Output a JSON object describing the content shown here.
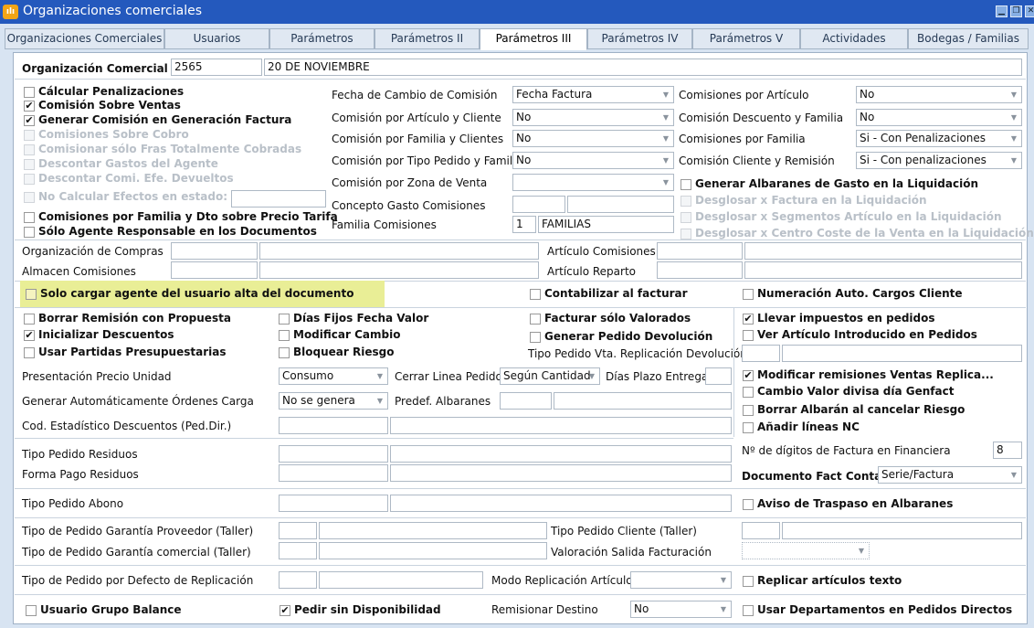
{
  "window": {
    "title": "Organizaciones comerciales",
    "min": "▁",
    "max": "❐",
    "close": "✕"
  },
  "tabs": [
    "Organizaciones Comerciales",
    "Usuarios",
    "Parámetros",
    "Parámetros II",
    "Parámetros III",
    "Parámetros IV",
    "Parámetros V",
    "Actividades",
    "Bodegas / Familias"
  ],
  "org": {
    "label": "Organización Comercial",
    "code": "2565",
    "name": "20 DE NOVIEMBRE"
  },
  "left_checks": [
    {
      "label": "Cálcular Penalizaciones",
      "checked": false,
      "disabled": false
    },
    {
      "label": "Comisión Sobre Ventas",
      "checked": true,
      "disabled": false
    },
    {
      "label": "Generar Comisión en Generación Factura",
      "checked": true,
      "disabled": false
    },
    {
      "label": "Comisiones Sobre Cobro",
      "checked": false,
      "disabled": true
    },
    {
      "label": "Comisionar sólo Fras Totalmente Cobradas",
      "checked": false,
      "disabled": true
    },
    {
      "label": "Descontar Gastos del Agente",
      "checked": false,
      "disabled": true
    },
    {
      "label": "Descontar Comi. Efe. Devueltos",
      "checked": false,
      "disabled": true
    },
    {
      "label": "No Calcular Efectos en estado:",
      "checked": false,
      "disabled": true
    },
    {
      "label": "Comisiones por Familia y Dto sobre Precio Tarifa",
      "checked": false,
      "disabled": false
    },
    {
      "label": "Sólo Agente Responsable en los Documentos",
      "checked": false,
      "disabled": false
    }
  ],
  "mid_fields": [
    {
      "label": "Fecha de Cambio de Comisión",
      "value": "Fecha Factura",
      "type": "select"
    },
    {
      "label": "Comisión por Artículo y Cliente",
      "value": "No",
      "type": "select"
    },
    {
      "label": "Comisión por Familia y Clientes",
      "value": "No",
      "type": "select"
    },
    {
      "label": "Comisión por Tipo Pedido y Familia",
      "value": "No",
      "type": "select"
    },
    {
      "label": "Comisión por Zona de Venta",
      "value": "",
      "type": "select"
    },
    {
      "label": "Concepto Gasto Comisiones",
      "value": "",
      "type": "input"
    },
    {
      "label": "Familia Comisiones",
      "value": "1",
      "value2": "FAMILIAS",
      "type": "input"
    }
  ],
  "right_fields": [
    {
      "label": "Comisiones por Artículo",
      "value": "No"
    },
    {
      "label": "Comisión Descuento y Familia",
      "value": "No"
    },
    {
      "label": "Comisiones por Familia",
      "value": "Si - Con Penalizaciones"
    },
    {
      "label": "Comisión Cliente y Remisión",
      "value": "Si - Con penalizaciones"
    }
  ],
  "right_checks": [
    {
      "label": "Generar Albaranes de Gasto en la Liquidación",
      "disabled": false
    },
    {
      "label": "Desglosar x Factura en la Liquidación",
      "disabled": true
    },
    {
      "label": "Desglosar x Segmentos Artículo en la Liquidación",
      "disabled": true
    },
    {
      "label": "Desglosar x Centro Coste de la Venta en la Liquidación",
      "disabled": true
    }
  ],
  "compras": {
    "label": "Organización de Compras"
  },
  "almacen": {
    "label": "Almacen Comisiones"
  },
  "art_com": {
    "label": "Artículo Comisiones"
  },
  "art_rep": {
    "label": "Artículo Reparto"
  },
  "highlight_check": {
    "label": "Solo cargar agente del usuario alta del documento"
  },
  "contabilizar": {
    "label": "Contabilizar al facturar"
  },
  "numeracion": {
    "label": "Numeración Auto. Cargos Cliente"
  },
  "checks_a": [
    {
      "label": "Borrar Remisión con Propuesta",
      "checked": false
    },
    {
      "label": "Inicializar Descuentos",
      "checked": true
    },
    {
      "label": "Usar Partidas Presupuestarias",
      "checked": false
    }
  ],
  "checks_b": [
    {
      "label": "Días Fijos Fecha Valor",
      "checked": false
    },
    {
      "label": "Modificar Cambio",
      "checked": false
    },
    {
      "label": "Bloquear Riesgo",
      "checked": false
    }
  ],
  "checks_c": [
    {
      "label": "Facturar sólo Valorados",
      "checked": false
    },
    {
      "label": "Generar Pedido Devolución",
      "checked": false
    }
  ],
  "tipo_repl_dev": {
    "label": "Tipo Pedido Vta. Replicación Devolución"
  },
  "checks_d": [
    {
      "label": "Llevar impuestos en pedidos",
      "checked": true
    },
    {
      "label": "Ver Artículo Introducido en Pedidos",
      "checked": false
    }
  ],
  "presentacion": {
    "label": "Presentación Precio Unidad",
    "value": "Consumo"
  },
  "cerrar": {
    "label": "Cerrar Linea Pedido",
    "value": "Según Cantidad"
  },
  "dias_plazo": {
    "label": "Días Plazo Entrega"
  },
  "generar_ord": {
    "label": "Generar Automáticamente Órdenes Carga",
    "value": "No se genera"
  },
  "predef": {
    "label": "Predef. Albaranes"
  },
  "cod_est": {
    "label": "Cod. Estadístico Descuentos (Ped.Dir.)"
  },
  "checks_e": [
    {
      "label": "Modificar remisiones Ventas Replica...",
      "checked": true
    },
    {
      "label": "Cambio Valor divisa día Genfact",
      "checked": false
    },
    {
      "label": "Borrar Albarán al cancelar Riesgo",
      "checked": false
    },
    {
      "label": "Añadir líneas NC",
      "checked": false
    }
  ],
  "tipo_residuos": {
    "label": "Tipo Pedido Residuos"
  },
  "forma_residuos": {
    "label": "Forma Pago Residuos"
  },
  "digitos": {
    "label": "Nº de dígitos de Factura en Financiera",
    "value": "8"
  },
  "doc_fact": {
    "label": "Documento Fact Conta",
    "value": "Serie/Factura"
  },
  "tipo_abono": {
    "label": "Tipo Pedido Abono"
  },
  "aviso": {
    "label": "Aviso de Traspaso en Albaranes"
  },
  "gar_prov": {
    "label": "Tipo de Pedido Garantía Proveedor (Taller)"
  },
  "gar_com": {
    "label": "Tipo de Pedido Garantía comercial (Taller)"
  },
  "tipo_cli_taller": {
    "label": "Tipo Pedido Cliente (Taller)"
  },
  "valoracion": {
    "label": "Valoración Salida Facturación"
  },
  "defecto_repl": {
    "label": "Tipo de Pedido por Defecto de Replicación"
  },
  "modo_repl": {
    "label": "Modo Replicación Artículo"
  },
  "replicar_texto": {
    "label": "Replicar artículos texto"
  },
  "usuario_grupo": {
    "label": "Usuario Grupo Balance"
  },
  "pedir_sin": {
    "label": "Pedir sin Disponibilidad",
    "checked": true
  },
  "remisionar": {
    "label": "Remisionar Destino",
    "value": "No"
  },
  "usar_deptos": {
    "label": "Usar Departamentos en Pedidos Directos"
  },
  "check_mark": "✔",
  "arrow": "▼"
}
